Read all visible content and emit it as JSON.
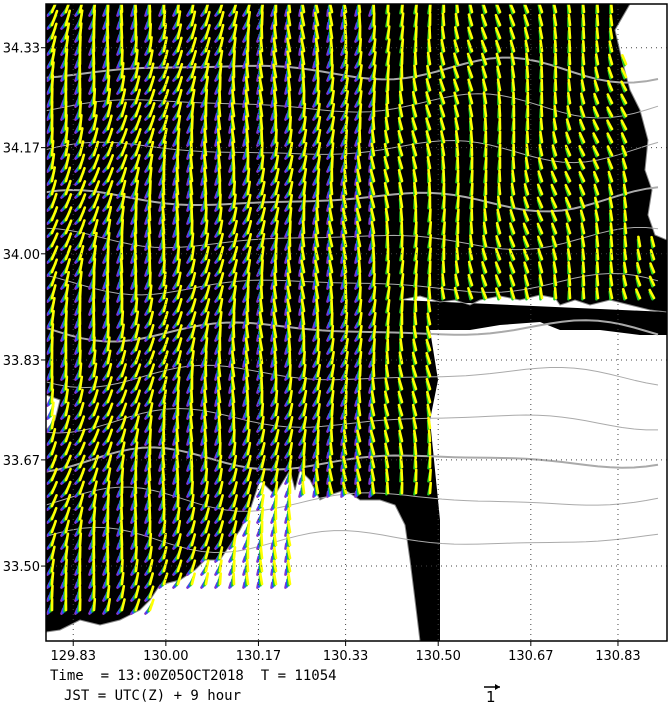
{
  "chart_data": {
    "type": "map",
    "description_type": "vector field over coastline",
    "xlabel": "",
    "ylabel": "",
    "x_ticks": [
      "129.83",
      "130.00",
      "130.17",
      "130.33",
      "130.50",
      "130.67",
      "130.83"
    ],
    "y_ticks": [
      "34.33",
      "34.17",
      "34.00",
      "33.83",
      "33.67",
      "33.50"
    ],
    "xlim": [
      129.78,
      130.92
    ],
    "ylim": [
      33.38,
      34.4
    ],
    "series": [
      {
        "color": "#ffff00"
      },
      {
        "color": "#22cc22"
      },
      {
        "color": "#2255ff"
      },
      {
        "color": "#8833cc"
      }
    ],
    "grid": "dotted",
    "land_color": "#ffffff",
    "sea_color": "#000000",
    "contour_color": "#aaaaaa"
  },
  "footer": {
    "time_line": "Time  = 13:00Z05OCT2018  T = 11054",
    "jst_line": "JST = UTC(Z) + 9 hour",
    "scale_label": "1"
  }
}
